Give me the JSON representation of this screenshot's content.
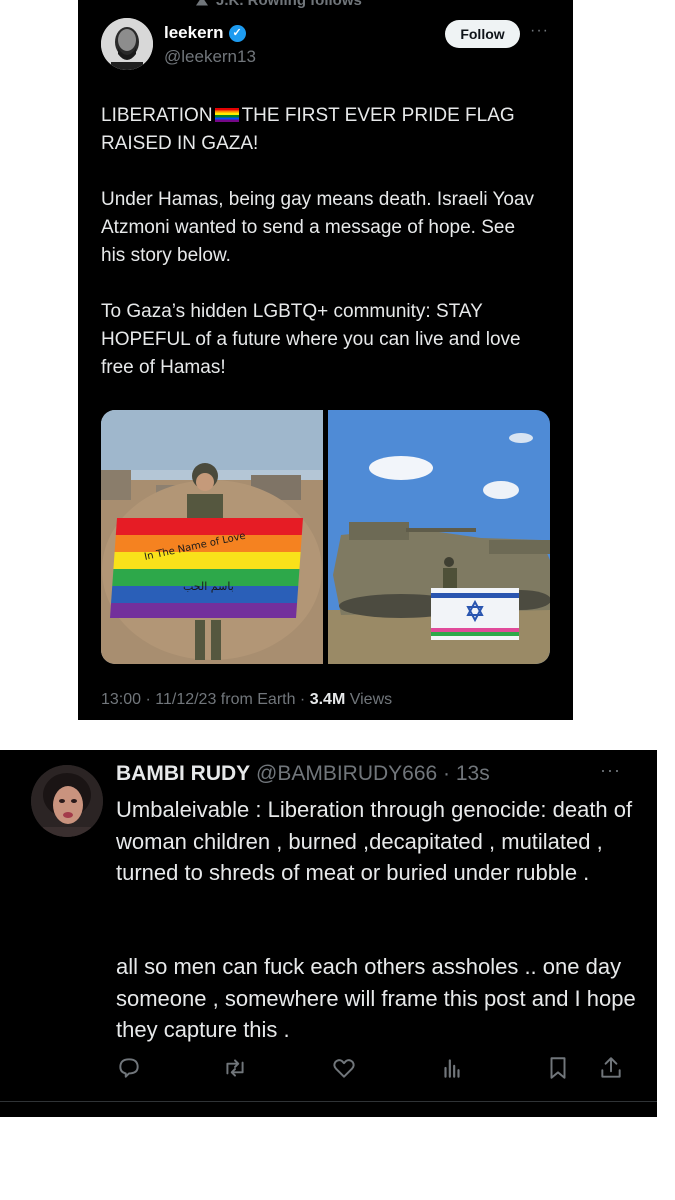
{
  "original_tweet": {
    "social_context": "J.K. Rowling follows",
    "author": {
      "name": "leekern",
      "handle": "@leekern13",
      "verified": true
    },
    "follow_label": "Follow",
    "more_label": "···",
    "text_line1_before_flag": "LIBERATION",
    "text_line1_after_flag": "THE FIRST EVER PRIDE FLAG",
    "text_line2": "RAISED IN GAZA!",
    "paragraph2": "Under Hamas, being gay means death. Israeli Yoav Atzmoni wanted to send a message of hope. See his story below.",
    "paragraph3": "To Gaza’s hidden LGBTQ+ community: STAY HOPEFUL of a future where you can live and love free of Hamas!",
    "images": [
      {
        "description": "soldier-holding-pride-flag",
        "flag_text_1": "In The Name of Love",
        "flag_text_2": "باسم الحب"
      },
      {
        "description": "soldier-with-israeli-pride-flag-by-tanks"
      }
    ],
    "meta_prefix": "13:00 · 11/12/23 from Earth · ",
    "views_count": "3.4M",
    "views_label": " Views"
  },
  "reply": {
    "author_name": "BAMBI RUDY",
    "handle_time": " @BAMBIRUDY666 · 13s",
    "more_label": "···",
    "paragraph1": "Umbaleivable : Liberation through genocide: death of woman children , burned ,decapitated , mutilated , turned to shreds of meat or buried under rubble .",
    "paragraph2": "all so men can fuck each others assholes .. one day someone , somewhere will frame this post and I hope they capture this .",
    "actions": [
      "reply-icon",
      "retweet-icon",
      "like-icon",
      "views-icon",
      "bookmark-icon",
      "share-icon"
    ]
  }
}
